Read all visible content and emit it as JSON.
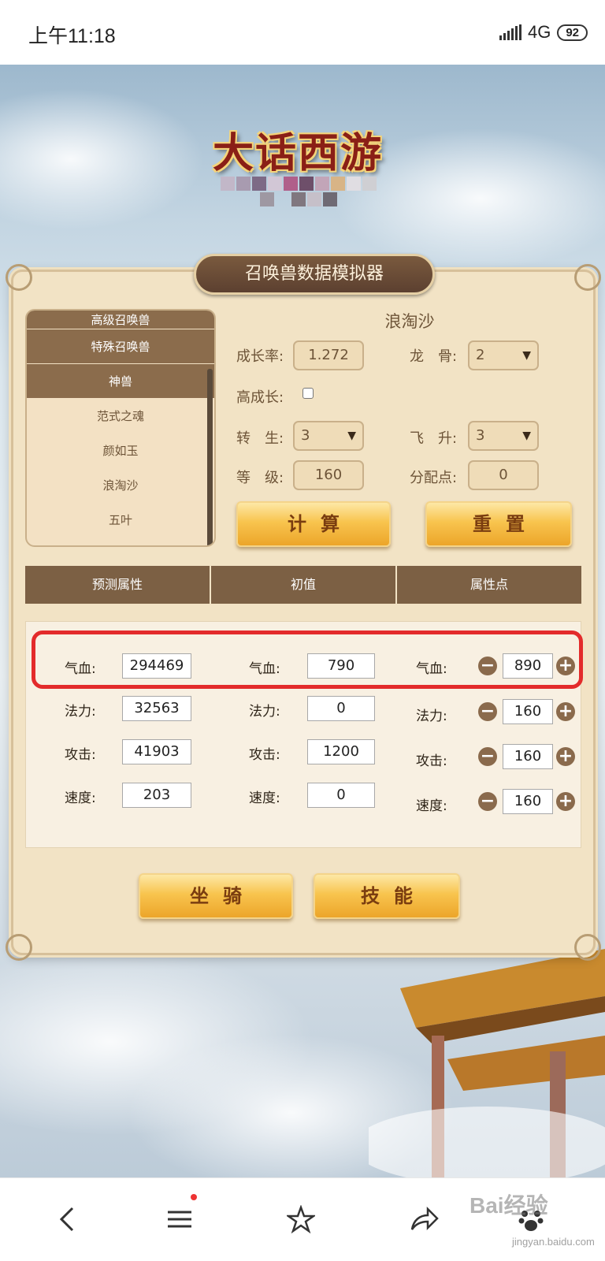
{
  "status": {
    "time": "上午11:18",
    "network": "4G",
    "battery": "92"
  },
  "logo": {
    "text": "大话西游"
  },
  "panel": {
    "title": "召唤兽数据模拟器"
  },
  "list": {
    "items": [
      {
        "label": "高级召唤兽",
        "style": "category"
      },
      {
        "label": "特殊召唤兽",
        "style": "category"
      },
      {
        "label": "神兽",
        "style": "category"
      },
      {
        "label": "范式之魂",
        "style": "item"
      },
      {
        "label": "颜如玉",
        "style": "item"
      },
      {
        "label": "浪淘沙",
        "style": "item"
      },
      {
        "label": "五叶",
        "style": "item"
      }
    ]
  },
  "form": {
    "species": "浪淘沙",
    "growth_label": "成长率:",
    "growth_value": "1.272",
    "bone_label": "龙　骨:",
    "bone_value": "2",
    "high_growth_label": "高成长:",
    "rebirth_label": "转　生:",
    "rebirth_value": "3",
    "ascend_label": "飞　升:",
    "ascend_value": "3",
    "level_label": "等　级:",
    "level_value": "160",
    "points_label": "分配点:",
    "points_value": "0",
    "calc_button": "计算",
    "reset_button": "重置"
  },
  "table": {
    "headers": [
      "预测属性",
      "初值",
      "属性点"
    ],
    "rows": [
      {
        "label": "气血:",
        "predicted": "294469",
        "initial": "790",
        "points": "890"
      },
      {
        "label": "法力:",
        "predicted": "32563",
        "initial": "0",
        "points": "160"
      },
      {
        "label": "攻击:",
        "predicted": "41903",
        "initial": "1200",
        "points": "160"
      },
      {
        "label": "速度:",
        "predicted": "203",
        "initial": "0",
        "points": "160"
      }
    ]
  },
  "bottom_buttons": {
    "mount": "坐骑",
    "skill": "技能"
  },
  "nav": {
    "icons": [
      "back-icon",
      "menu-icon",
      "star-icon",
      "share-icon",
      "paw-icon"
    ],
    "watermark": "Bai经验",
    "watermark_sub": "jingyan.baidu.com"
  },
  "colors": {
    "panel": "#f2e3c5",
    "header": "#7c6044",
    "button": "#f8c44e",
    "highlight": "#e32b2b"
  }
}
